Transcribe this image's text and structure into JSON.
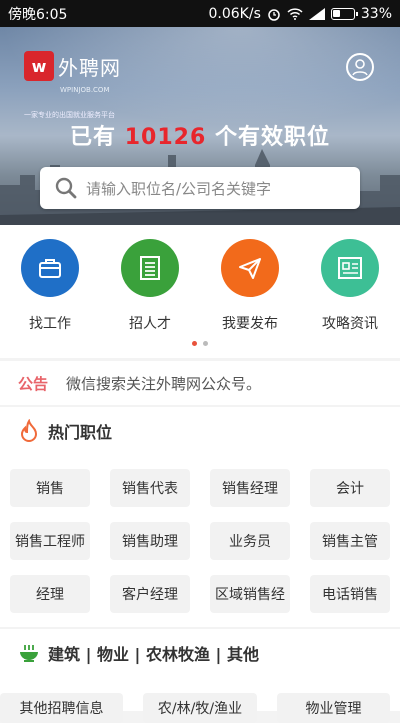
{
  "status": {
    "time": "傍晚6:05",
    "speed": "0.06K/s",
    "battery": "33%"
  },
  "logo": {
    "name": "外聘网",
    "domain": "WPINJOB.COM",
    "tagline": "一家专业的出国就业服务平台"
  },
  "hero": {
    "prefix": "已有",
    "count": "10126",
    "suffix": "个有效职位"
  },
  "search": {
    "placeholder": "请输入职位名/公司名关键字"
  },
  "quick_actions": [
    {
      "label": "找工作",
      "color": "#1f6fc7",
      "icon": "briefcase-icon"
    },
    {
      "label": "招人才",
      "color": "#3aa13b",
      "icon": "document-icon"
    },
    {
      "label": "我要发布",
      "color": "#f26a1b",
      "icon": "paper-plane-icon"
    },
    {
      "label": "攻略资讯",
      "color": "#3dbf95",
      "icon": "news-icon"
    }
  ],
  "notice": {
    "tag": "公告",
    "message": "微信搜索关注外聘网公众号。"
  },
  "hot_jobs": {
    "title": "热门职位",
    "items": [
      "销售",
      "销售代表",
      "销售经理",
      "会计",
      "销售工程师",
      "销售助理",
      "业务员",
      "销售主管",
      "经理",
      "客户经理",
      "区域销售经",
      "电话销售"
    ]
  },
  "category": {
    "title": "建筑 | 物业 | 农林牧渔 | 其他",
    "items": [
      "其他招聘信息",
      "农/林/牧/渔业",
      "物业管理"
    ]
  }
}
